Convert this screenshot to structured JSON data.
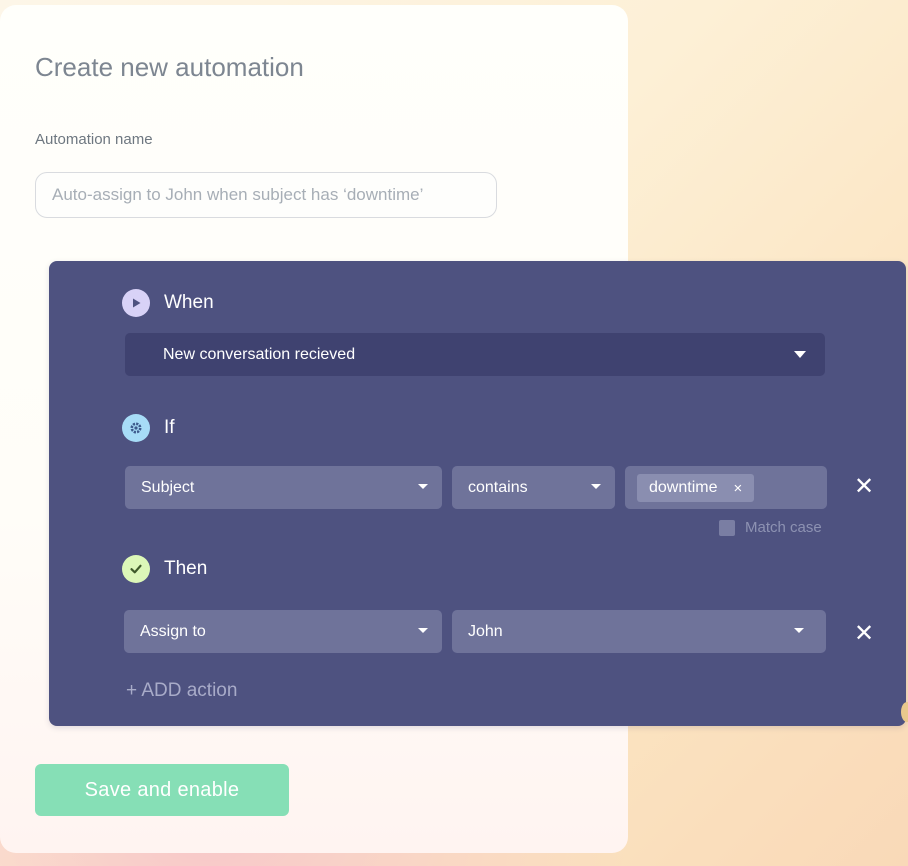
{
  "page": {
    "title": "Create new automation"
  },
  "name_field": {
    "label": "Automation name",
    "placeholder": "Auto-assign to John when subject has ‘downtime’",
    "value": ""
  },
  "when": {
    "heading": "When",
    "icon": "play-icon",
    "trigger": "New conversation recieved"
  },
  "if": {
    "heading": "If",
    "icon": "gear-icon",
    "field": "Subject",
    "operator": "contains",
    "value_chip": "downtime",
    "chip_remove": "×",
    "match_case_label": "Match case",
    "match_case_checked": false,
    "remove": "✕"
  },
  "then": {
    "heading": "Then",
    "icon": "check-icon",
    "action": "Assign to",
    "target": "John",
    "remove": "✕"
  },
  "add_action": "+ ADD action",
  "save_button": "Save and enable",
  "colors": {
    "builder_bg": "#4e5280",
    "dropdown_bg": "#6f739a",
    "trigger_bg": "#3f4270",
    "save_bg": "#86dfb6",
    "when_icon": "#d8d2f7",
    "if_icon": "#a7dcf7",
    "then_icon": "#dcf7b8"
  }
}
